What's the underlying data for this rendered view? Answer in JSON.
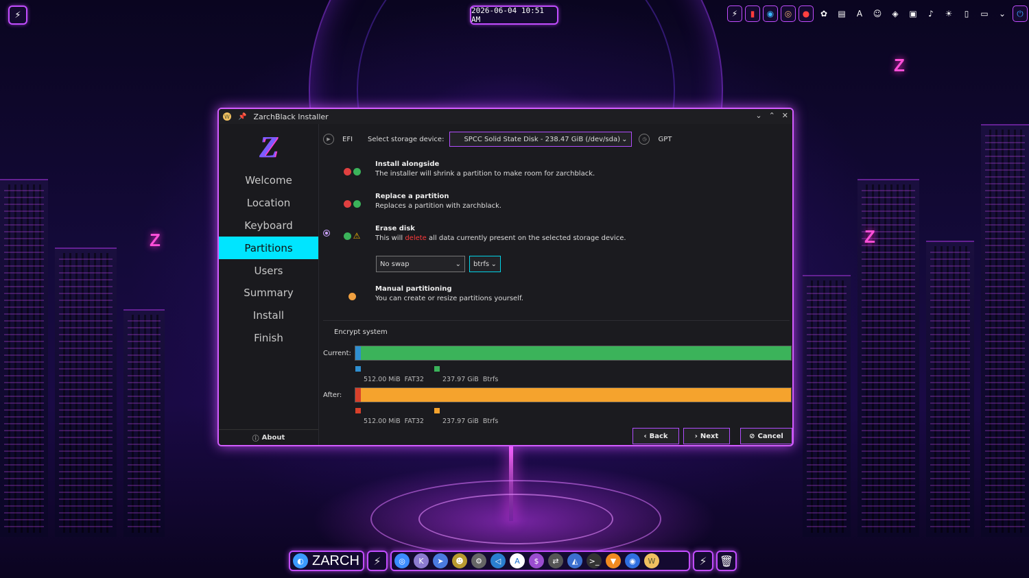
{
  "topbar": {
    "launcher_icon": "zarch-launcher-icon",
    "clock": "2026-06-04 10:51 AM",
    "tray_icons": [
      "zarch-icon",
      "power-red-icon",
      "browser-icon",
      "donut-icon",
      "red-app-icon",
      "palette-icon",
      "panel-icon",
      "font-icon",
      "user-icon",
      "network-icon",
      "terminal-icon",
      "volume-icon",
      "brightness-icon",
      "usb-icon",
      "display-icon",
      "chevron-down-icon",
      "power-icon"
    ]
  },
  "window": {
    "title": "ZarchBlack Installer",
    "sidebar": {
      "items": [
        "Welcome",
        "Location",
        "Keyboard",
        "Partitions",
        "Users",
        "Summary",
        "Install",
        "Finish"
      ],
      "active": "Partitions",
      "about": "About"
    },
    "device_row": {
      "efi": "EFI",
      "select_label": "Select storage device:",
      "device": "SPCC Solid State Disk - 238.47 GiB (/dev/sda)",
      "table_type": "GPT"
    },
    "options": [
      {
        "title": "Install alongside",
        "desc": "The installer will shrink a partition to make room for zarchblack."
      },
      {
        "title": "Replace a partition",
        "desc": "Replaces a partition with zarchblack."
      },
      {
        "title": "Erase disk",
        "desc_before": "This will ",
        "desc_delete": "delete",
        "desc_after": " all data currently present on the selected storage device."
      },
      {
        "title": "Manual partitioning",
        "desc": "You can create or resize partitions yourself."
      }
    ],
    "swap": "No swap",
    "filesystem": "btrfs",
    "encrypt": "Encrypt system",
    "current": {
      "label": "Current:",
      "legend": [
        {
          "size": "512.00 MiB",
          "fs": "FAT32",
          "color": "#2f8fd0"
        },
        {
          "size": "237.97 GiB",
          "fs": "Btrfs",
          "color": "#3bb35a"
        }
      ]
    },
    "after": {
      "label": "After:",
      "legend": [
        {
          "size": "512.00 MiB",
          "fs": "FAT32",
          "color": "#d8402a"
        },
        {
          "size": "237.97 GiB",
          "fs": "Btrfs",
          "color": "#f5a32d"
        }
      ]
    },
    "buttons": {
      "back": "Back",
      "next": "Next",
      "cancel": "Cancel"
    }
  },
  "dock": {
    "brand": "ZARCH",
    "apps": [
      "chromium-icon",
      "kvantum-icon",
      "telegram-icon",
      "cat-icon",
      "settings-icon",
      "vscode-icon",
      "archstore-icon",
      "shop-icon",
      "switch-icon",
      "dolphin-icon",
      "terminal-icon",
      "brave-icon",
      "chrome-icon",
      "install-icon"
    ],
    "trash_icon": "trash-icon"
  }
}
